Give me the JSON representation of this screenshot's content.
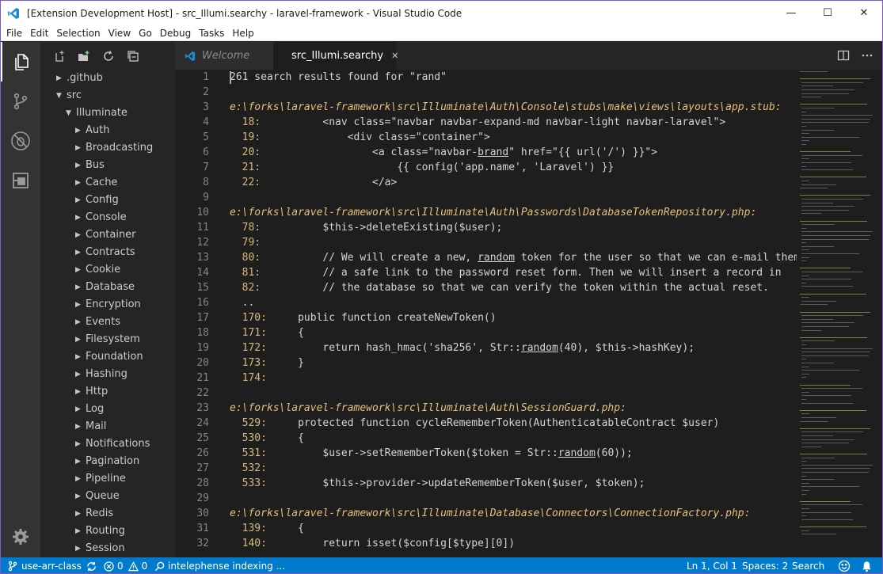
{
  "window": {
    "title": "[Extension Development Host] - src_Illumi.searchy - laravel-framework - Visual Studio Code",
    "minimize_glyph": "—",
    "maximize_glyph": "☐",
    "close_glyph": "✕"
  },
  "menu": [
    "File",
    "Edit",
    "Selection",
    "View",
    "Go",
    "Debug",
    "Tasks",
    "Help"
  ],
  "explorer": {
    "items": [
      {
        "label": ".github",
        "depth": 0,
        "expanded": false
      },
      {
        "label": "src",
        "depth": 0,
        "expanded": true
      },
      {
        "label": "Illuminate",
        "depth": 1,
        "expanded": true
      },
      {
        "label": "Auth",
        "depth": 2,
        "expanded": false
      },
      {
        "label": "Broadcasting",
        "depth": 2,
        "expanded": false
      },
      {
        "label": "Bus",
        "depth": 2,
        "expanded": false
      },
      {
        "label": "Cache",
        "depth": 2,
        "expanded": false
      },
      {
        "label": "Config",
        "depth": 2,
        "expanded": false
      },
      {
        "label": "Console",
        "depth": 2,
        "expanded": false
      },
      {
        "label": "Container",
        "depth": 2,
        "expanded": false
      },
      {
        "label": "Contracts",
        "depth": 2,
        "expanded": false
      },
      {
        "label": "Cookie",
        "depth": 2,
        "expanded": false
      },
      {
        "label": "Database",
        "depth": 2,
        "expanded": false
      },
      {
        "label": "Encryption",
        "depth": 2,
        "expanded": false
      },
      {
        "label": "Events",
        "depth": 2,
        "expanded": false
      },
      {
        "label": "Filesystem",
        "depth": 2,
        "expanded": false
      },
      {
        "label": "Foundation",
        "depth": 2,
        "expanded": false
      },
      {
        "label": "Hashing",
        "depth": 2,
        "expanded": false
      },
      {
        "label": "Http",
        "depth": 2,
        "expanded": false
      },
      {
        "label": "Log",
        "depth": 2,
        "expanded": false
      },
      {
        "label": "Mail",
        "depth": 2,
        "expanded": false
      },
      {
        "label": "Notifications",
        "depth": 2,
        "expanded": false
      },
      {
        "label": "Pagination",
        "depth": 2,
        "expanded": false
      },
      {
        "label": "Pipeline",
        "depth": 2,
        "expanded": false
      },
      {
        "label": "Queue",
        "depth": 2,
        "expanded": false
      },
      {
        "label": "Redis",
        "depth": 2,
        "expanded": false
      },
      {
        "label": "Routing",
        "depth": 2,
        "expanded": false
      },
      {
        "label": "Session",
        "depth": 2,
        "expanded": false
      }
    ]
  },
  "tabs": [
    {
      "label": "Welcome",
      "active": false
    },
    {
      "label": "src_Illumi.searchy",
      "active": true,
      "close_glyph": "✕"
    }
  ],
  "editor": {
    "lines": [
      {
        "n": "1",
        "segs": [
          {
            "t": "261 search results found for \"rand\""
          }
        ]
      },
      {
        "n": "2",
        "segs": []
      },
      {
        "n": "3",
        "segs": [
          {
            "t": "e:\\forks\\laravel-framework\\src\\Illuminate\\Auth\\Console\\stubs\\make\\views\\layouts\\app.stub:",
            "c": "path"
          }
        ]
      },
      {
        "n": "4",
        "segs": [
          {
            "t": "  18:",
            "c": "num"
          },
          {
            "t": "          <nav class=\"navbar navbar-expand-md navbar-light navbar-laravel\">"
          }
        ]
      },
      {
        "n": "5",
        "segs": [
          {
            "t": "  19:",
            "c": "num"
          },
          {
            "t": "              <div class=\"container\">"
          }
        ]
      },
      {
        "n": "6",
        "segs": [
          {
            "t": "  20:",
            "c": "num"
          },
          {
            "t": "                  <a class=\"navbar-"
          },
          {
            "t": "brand",
            "c": "u"
          },
          {
            "t": "\" href=\"{{ url('/') }}\">"
          }
        ]
      },
      {
        "n": "7",
        "segs": [
          {
            "t": "  21:",
            "c": "num"
          },
          {
            "t": "                      {{ config('app.name', 'Laravel') }}"
          }
        ]
      },
      {
        "n": "8",
        "segs": [
          {
            "t": "  22:",
            "c": "num"
          },
          {
            "t": "                  </a>"
          }
        ]
      },
      {
        "n": "9",
        "segs": []
      },
      {
        "n": "10",
        "segs": [
          {
            "t": "e:\\forks\\laravel-framework\\src\\Illuminate\\Auth\\Passwords\\DatabaseTokenRepository.php:",
            "c": "path"
          }
        ]
      },
      {
        "n": "11",
        "segs": [
          {
            "t": "  78:",
            "c": "num"
          },
          {
            "t": "          $this->deleteExisting($user);"
          }
        ]
      },
      {
        "n": "12",
        "segs": [
          {
            "t": "  79:",
            "c": "num"
          }
        ]
      },
      {
        "n": "13",
        "segs": [
          {
            "t": "  80:",
            "c": "num"
          },
          {
            "t": "          // We will create a new, "
          },
          {
            "t": "random",
            "c": "u"
          },
          {
            "t": " token for the user so that we can e-mail them"
          }
        ]
      },
      {
        "n": "14",
        "segs": [
          {
            "t": "  81:",
            "c": "num"
          },
          {
            "t": "          // a safe link to the password reset form. Then we will insert a record in"
          }
        ]
      },
      {
        "n": "15",
        "segs": [
          {
            "t": "  82:",
            "c": "num"
          },
          {
            "t": "          // the database so that we can verify the token within the actual reset."
          }
        ]
      },
      {
        "n": "16",
        "segs": [
          {
            "t": "  .."
          }
        ]
      },
      {
        "n": "17",
        "segs": [
          {
            "t": "  170:",
            "c": "num"
          },
          {
            "t": "     public function createNewToken()"
          }
        ]
      },
      {
        "n": "18",
        "segs": [
          {
            "t": "  171:",
            "c": "num"
          },
          {
            "t": "     {"
          }
        ]
      },
      {
        "n": "19",
        "segs": [
          {
            "t": "  172:",
            "c": "num"
          },
          {
            "t": "         return hash_hmac('sha256', Str::"
          },
          {
            "t": "random",
            "c": "u"
          },
          {
            "t": "(40), $this->hashKey);"
          }
        ]
      },
      {
        "n": "20",
        "segs": [
          {
            "t": "  173:",
            "c": "num"
          },
          {
            "t": "     }"
          }
        ]
      },
      {
        "n": "21",
        "segs": [
          {
            "t": "  174:",
            "c": "num"
          }
        ]
      },
      {
        "n": "22",
        "segs": []
      },
      {
        "n": "23",
        "segs": [
          {
            "t": "e:\\forks\\laravel-framework\\src\\Illuminate\\Auth\\SessionGuard.php:",
            "c": "path"
          }
        ]
      },
      {
        "n": "24",
        "segs": [
          {
            "t": "  529:",
            "c": "num"
          },
          {
            "t": "     protected function cycleRememberToken(AuthenticatableContract $user)"
          }
        ]
      },
      {
        "n": "25",
        "segs": [
          {
            "t": "  530:",
            "c": "num"
          },
          {
            "t": "     {"
          }
        ]
      },
      {
        "n": "26",
        "segs": [
          {
            "t": "  531:",
            "c": "num"
          },
          {
            "t": "         $user->setRememberToken($token = Str::"
          },
          {
            "t": "random",
            "c": "u"
          },
          {
            "t": "(60));"
          }
        ]
      },
      {
        "n": "27",
        "segs": [
          {
            "t": "  532:",
            "c": "num"
          }
        ]
      },
      {
        "n": "28",
        "segs": [
          {
            "t": "  533:",
            "c": "num"
          },
          {
            "t": "         $this->provider->updateRememberToken($user, $token);"
          }
        ]
      },
      {
        "n": "29",
        "segs": []
      },
      {
        "n": "30",
        "segs": [
          {
            "t": "e:\\forks\\laravel-framework\\src\\Illuminate\\Database\\Connectors\\ConnectionFactory.php:",
            "c": "path"
          }
        ]
      },
      {
        "n": "31",
        "segs": [
          {
            "t": "  139:",
            "c": "num"
          },
          {
            "t": "     {"
          }
        ]
      },
      {
        "n": "32",
        "segs": [
          {
            "t": "  140:",
            "c": "num"
          },
          {
            "t": "         return isset($config[$type][0])"
          }
        ]
      }
    ]
  },
  "status": {
    "branch": "use-arr-class",
    "errors": "0",
    "warnings": "0",
    "indexing": "intelephense indexing ...",
    "position": "Ln 1, Col 1",
    "spaces": "Spaces: 2",
    "language": "Search"
  },
  "colors": {
    "accent": "#007acc",
    "path": "#e5c07b",
    "line_num": "#d7ba7d"
  }
}
